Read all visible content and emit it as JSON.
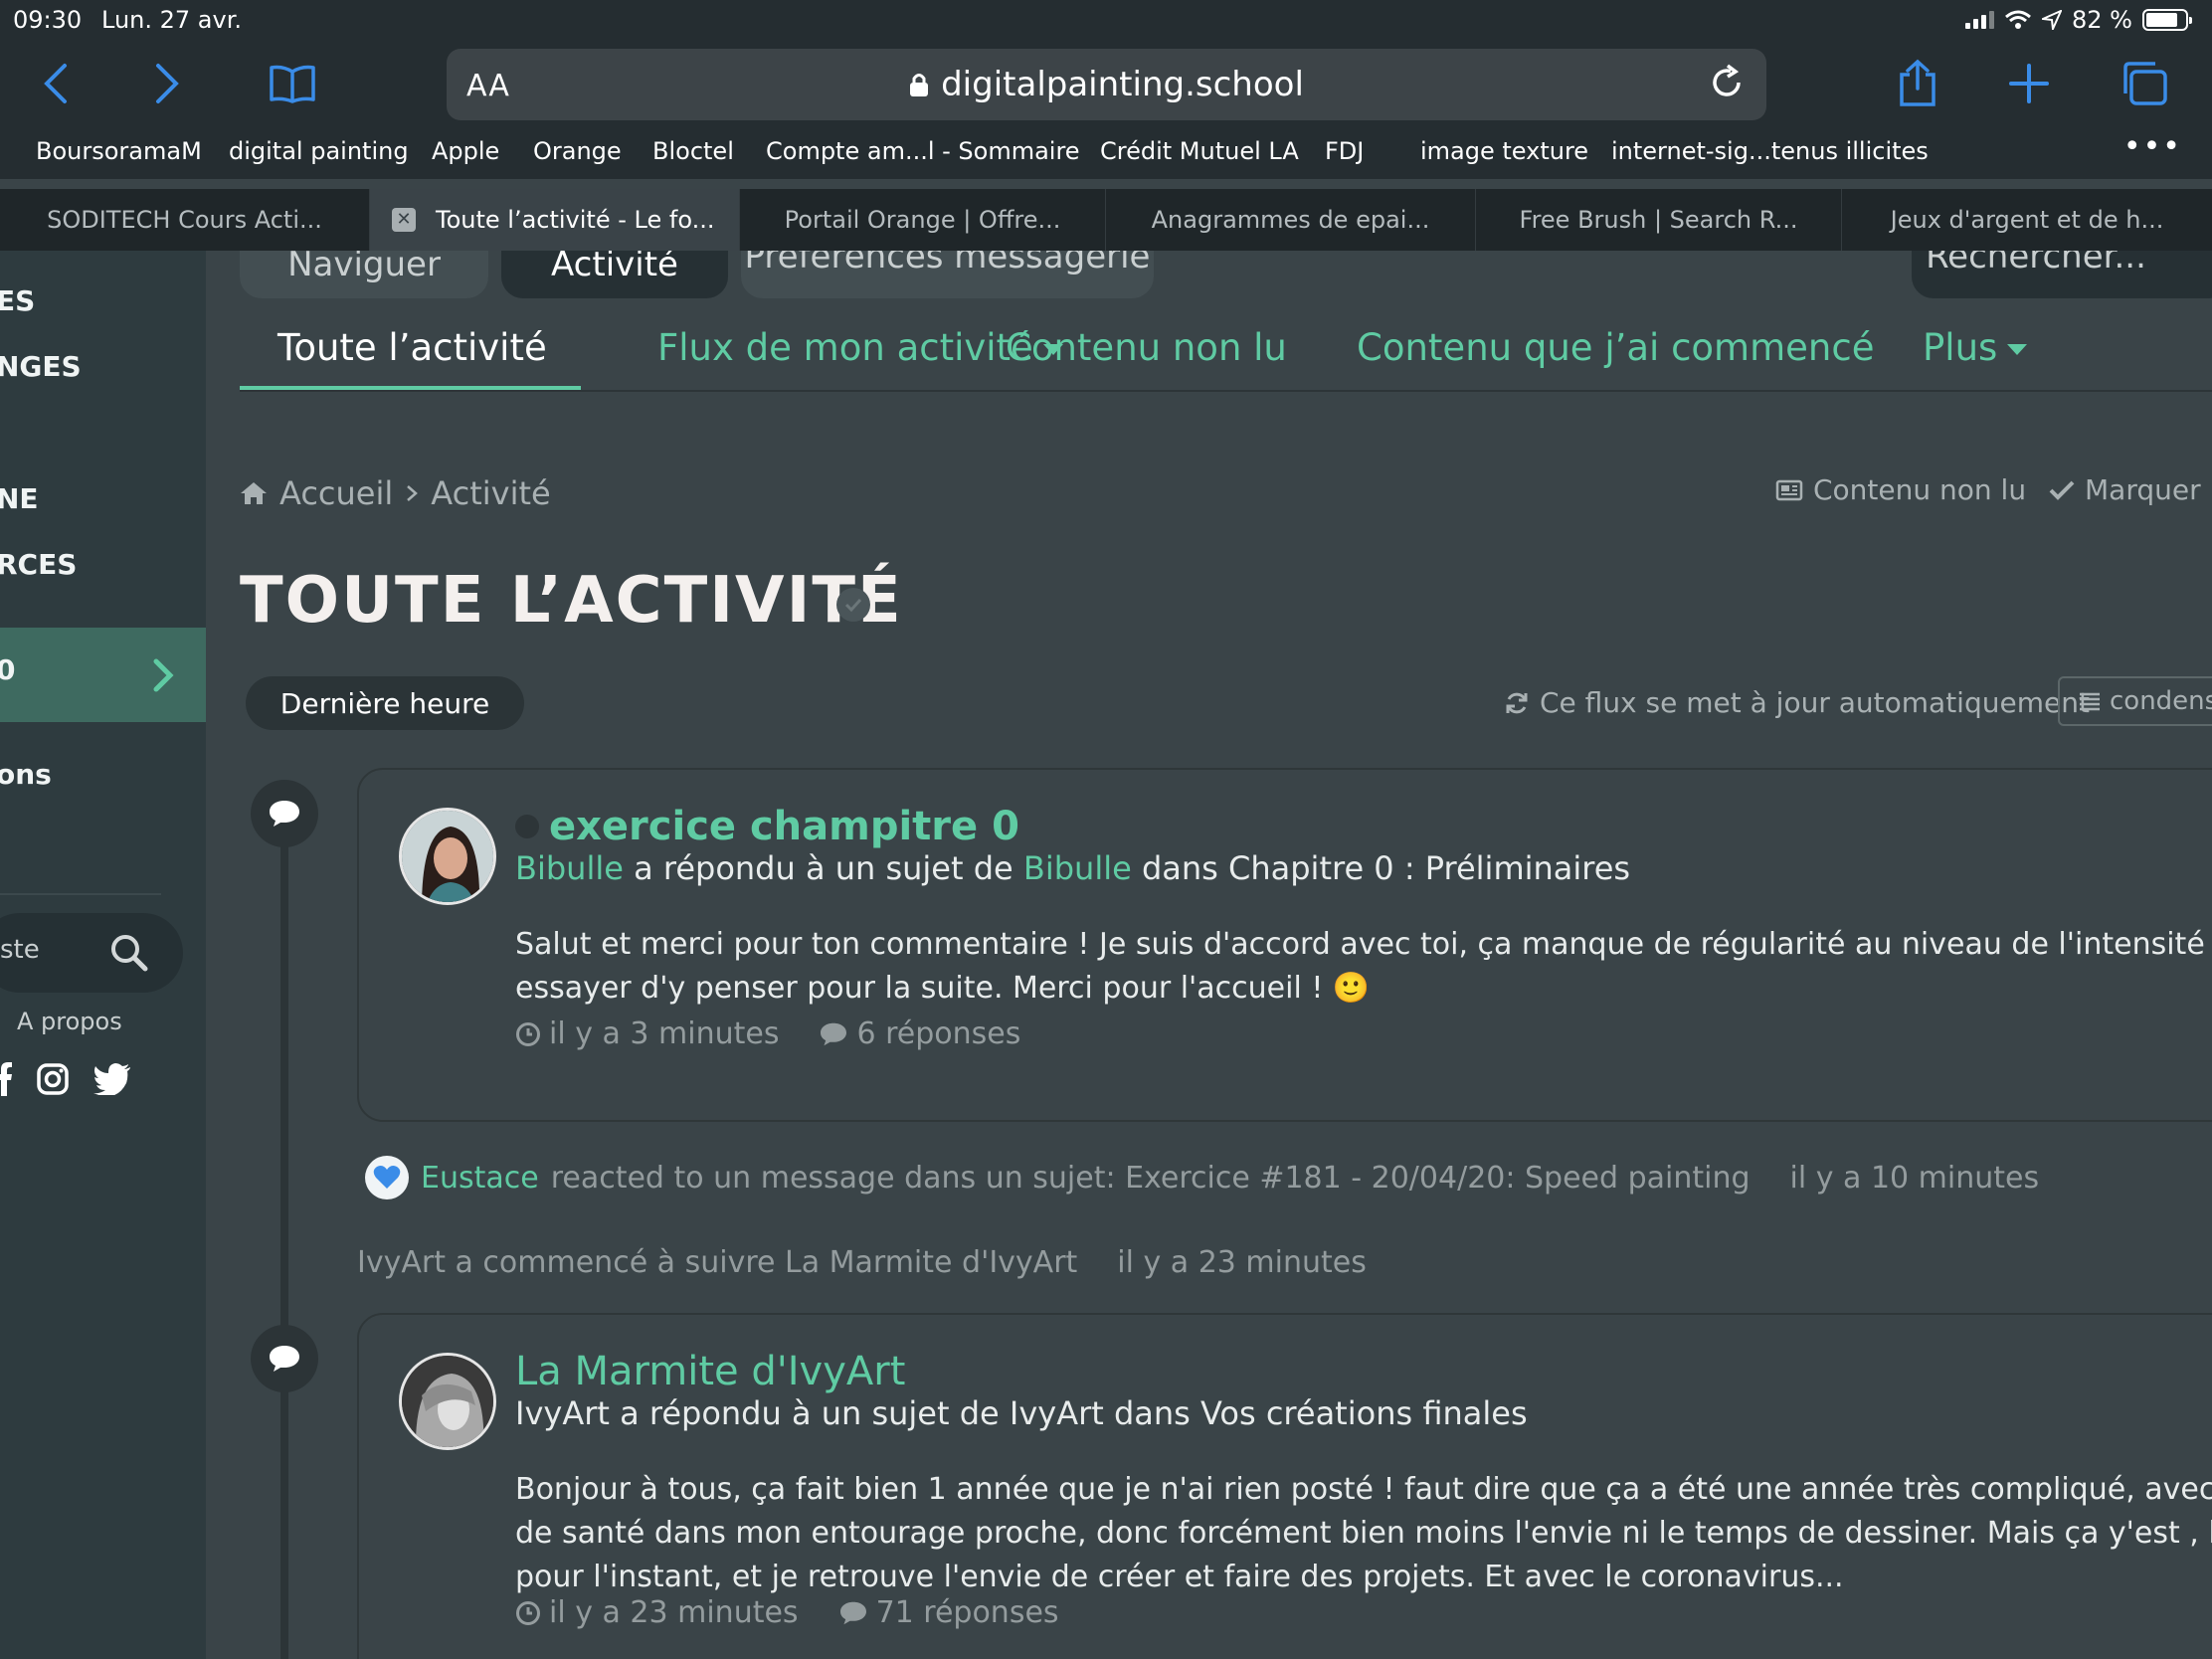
{
  "status": {
    "time": "09:30",
    "date": "Lun. 27 avr.",
    "battery": "82 %",
    "battery_level": 0.82
  },
  "url": {
    "aa_label": "AA",
    "domain": "digitalpainting.school"
  },
  "favorites": [
    "BoursoramaM",
    "digital painting",
    "Apple",
    "Orange",
    "Bloctel",
    "Compte am...l - Sommaire",
    "Crédit Mutuel LA",
    "FDJ",
    "image texture",
    "internet-sig...tenus illicites"
  ],
  "tabs": [
    {
      "label": "SODITECH Cours Acti..."
    },
    {
      "label": "Toute l’activité - Le fo..."
    },
    {
      "label": "Portail Orange | Offre..."
    },
    {
      "label": "Anagrammes de epai..."
    },
    {
      "label": "Free Brush | Search R..."
    },
    {
      "label": "Jeux d'argent et de h..."
    }
  ],
  "sidebar": {
    "items": [
      "ES",
      "NGES",
      "NE",
      "RCES",
      "0",
      "ons"
    ],
    "search_placeholder": "ste",
    "about": "A propos"
  },
  "top_nav": {
    "browse": "Naviguer",
    "activity": "Activité",
    "messaging": "Préférences messagerie",
    "search": "Rechercher..."
  },
  "subnav": {
    "all_activity": "Toute l’activité",
    "my_stream": "Flux de mon activité",
    "unread": "Contenu non lu",
    "started": "Contenu que j’ai commencé",
    "more": "Plus"
  },
  "breadcrumb": {
    "home": "Accueil",
    "current": "Activité"
  },
  "crumb_tools": {
    "unread": "Contenu non lu",
    "mark": "Marquer l"
  },
  "page_title": "TOUTE L’ACTIVITÉ",
  "filter": {
    "label": "Dernière heure"
  },
  "auto_update": "Ce flux se met à jour automatiquement",
  "condense": "condensé",
  "feed": {
    "post1": {
      "title": "exercice champitre 0",
      "author": "Bibulle",
      "action": "a répondu à un sujet de",
      "topic_author": "Bibulle",
      "location": "dans Chapitre 0 : Préliminaires",
      "body_line1": "Salut et merci pour ton commentaire ! Je suis d'accord avec toi, ça manque de régularité au niveau de l'intensité des ombres. Je",
      "body_line2": "essayer d'y penser pour la suite. Merci pour l'accueil ! 🙂",
      "time": "il y a 3 minutes",
      "replies": "6 réponses"
    },
    "reaction": {
      "user": "Eustace",
      "text": "reacted to un message dans un sujet: Exercice #181 - 20/04/20: Speed painting",
      "time": "il y a 10 minutes"
    },
    "follow": {
      "text": "IvyArt a commencé à suivre La Marmite d'IvyArt",
      "time": "il y a 23 minutes"
    },
    "post2": {
      "title": "La Marmite d'IvyArt",
      "meta": "IvyArt a répondu à un sujet de IvyArt dans Vos créations finales",
      "body_line1": "Bonjour à tous, ça fait bien 1 année que je n'ai rien posté ! faut dire que ça a été une année très compliqué, avec beaucoup de p",
      "body_line2": "de santé dans mon entourage proche, donc forcément bien moins l'envie ni le temps de dessiner. Mais ça y'est , le pire est derr",
      "body_line3": "pour l'instant, et je retrouve l'envie de créer et faire des projets. Et avec le coronavirus...",
      "time": "il y a 23 minutes",
      "replies": "71 réponses"
    }
  },
  "colors": {
    "accent": "#5fcba3",
    "background": "#3a4448",
    "sidebar": "#2e3b3f",
    "browser_chrome": "#252d31"
  }
}
